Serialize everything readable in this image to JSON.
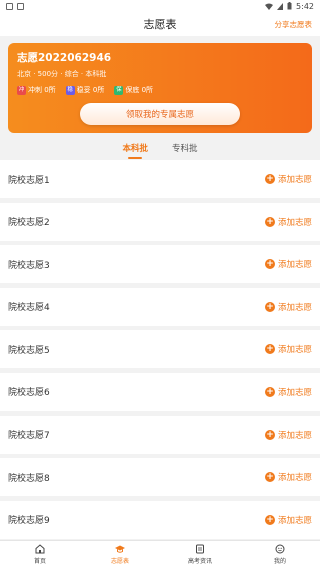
{
  "status": {
    "time": "5:42"
  },
  "header": {
    "title": "志愿表",
    "share_label": "分享志愿表"
  },
  "hero": {
    "id_text": "志愿2022062946",
    "sub_text": "北京 · 500分 · 综合 · 本科批",
    "stats": [
      {
        "tag": "冲",
        "label": "冲刺 0所",
        "color": "#e94b4b"
      },
      {
        "tag": "稳",
        "label": "稳妥 0所",
        "color": "#6c5ce7"
      },
      {
        "tag": "保",
        "label": "保底 0所",
        "color": "#2fb86f"
      }
    ],
    "button_label": "领取我的专属志愿"
  },
  "tabs": [
    {
      "label": "本科批",
      "active": true
    },
    {
      "label": "专科批",
      "active": false
    }
  ],
  "rows": [
    {
      "label": "院校志愿1",
      "action": "添加志愿"
    },
    {
      "label": "院校志愿2",
      "action": "添加志愿"
    },
    {
      "label": "院校志愿3",
      "action": "添加志愿"
    },
    {
      "label": "院校志愿4",
      "action": "添加志愿"
    },
    {
      "label": "院校志愿5",
      "action": "添加志愿"
    },
    {
      "label": "院校志愿6",
      "action": "添加志愿"
    },
    {
      "label": "院校志愿7",
      "action": "添加志愿"
    },
    {
      "label": "院校志愿8",
      "action": "添加志愿"
    },
    {
      "label": "院校志愿9",
      "action": "添加志愿"
    }
  ],
  "tabbar": [
    {
      "label": "首页",
      "icon": "home-icon",
      "active": false
    },
    {
      "label": "志愿表",
      "icon": "graduation-cap-icon",
      "active": true
    },
    {
      "label": "高考资讯",
      "icon": "news-icon",
      "active": false
    },
    {
      "label": "我的",
      "icon": "profile-icon",
      "active": false
    }
  ],
  "colors": {
    "accent": "#f07a1c",
    "hero_start": "#f58d1e",
    "hero_end": "#f46a1a"
  }
}
